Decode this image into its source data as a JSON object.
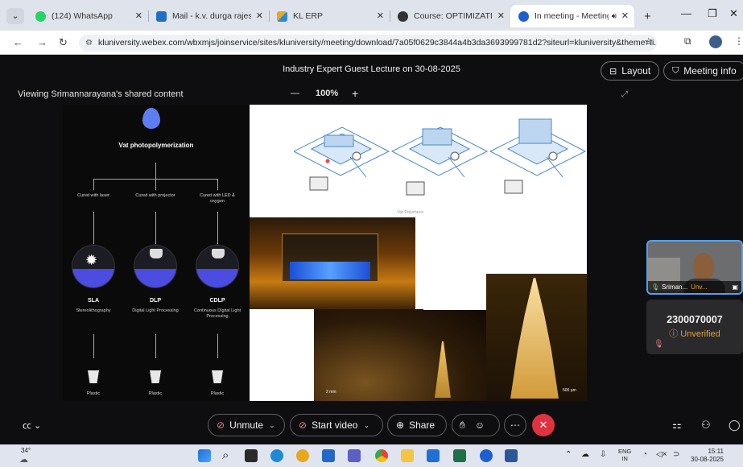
{
  "browser": {
    "tabs": [
      {
        "title": "(124) WhatsApp",
        "color": "#25d366"
      },
      {
        "title": "Mail - k.v. durga rajesh -",
        "color": "#1f6fc4"
      },
      {
        "title": "KL ERP",
        "color": "#e8a71c"
      },
      {
        "title": "Course: OPTIMIZATION",
        "color": "#333333"
      },
      {
        "title": "In meeting - Meeting",
        "color": "#1d5fd1",
        "active": true
      }
    ],
    "url": "kluniversity.webex.com/wbxmjs/joinservice/sites/kluniversity/meeting/download/7a05f0629c3844a4b3da3693999781d2?siteurl=kluniversity&theme=li..."
  },
  "meeting": {
    "title": "Industry Expert Guest Lecture on 30-08-2025",
    "layout_label": "Layout",
    "info_label": "Meeting info",
    "sharing_text": "Viewing Srimannarayana's shared content",
    "zoom": "100%"
  },
  "slide": {
    "title": "Vat photopolymerization",
    "branches": [
      {
        "label": "Cured with laser",
        "name": "SLA",
        "desc": "Stereolithography",
        "material": "Plastic"
      },
      {
        "label": "Cured with projector",
        "name": "DLP",
        "desc": "Digital Light Processing",
        "material": "Plastic"
      },
      {
        "label": "Cured with LED & oxygen",
        "name": "CDLP",
        "desc": "Continuous Digital Light Processing",
        "material": "Plastic"
      }
    ],
    "diagram_caption": "Vat Polymerization using a laser",
    "scale1": "2 mm",
    "scale2": "500 µm"
  },
  "participants": {
    "video_name": "Sriman...",
    "video_status": "Unv...",
    "id_number": "2300070007",
    "id_status": "Unverified"
  },
  "controls": {
    "unmute": "Unmute",
    "start_video": "Start video",
    "share": "Share"
  },
  "taskbar": {
    "temp": "34°",
    "lang_top": "ENG",
    "lang_bottom": "IN",
    "time": "15:11",
    "date": "30-08-2025"
  }
}
